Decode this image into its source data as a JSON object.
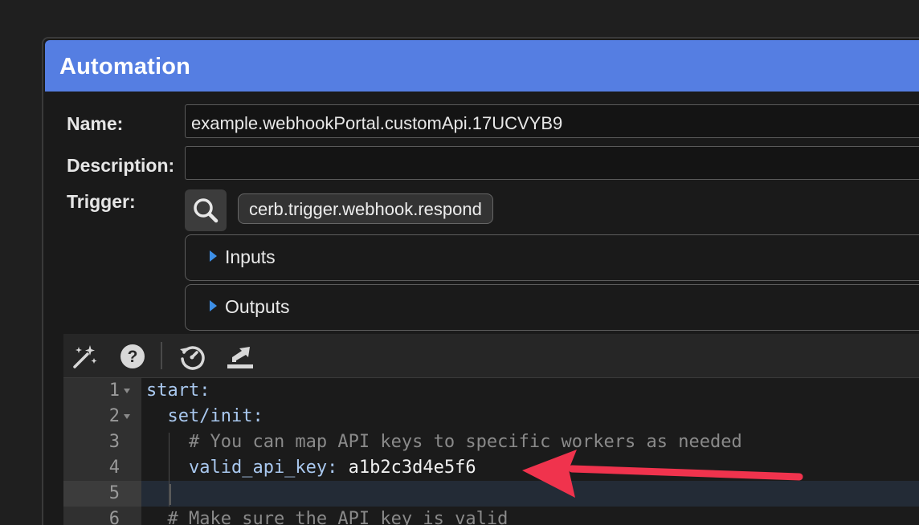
{
  "dialog": {
    "title": "Automation"
  },
  "form": {
    "name_label": "Name:",
    "name_value": "example.webhookPortal.customApi.17UCVYB9",
    "description_label": "Description:",
    "description_value": "",
    "trigger_label": "Trigger:",
    "trigger_value": "cerb.trigger.webhook.respond",
    "inputs_label": "Inputs",
    "outputs_label": "Outputs"
  },
  "toolbar": {
    "icons": [
      "magic-wand-icon",
      "help-icon",
      "history-icon",
      "export-icon"
    ]
  },
  "editor": {
    "lines": [
      {
        "number": "1",
        "text": "start:",
        "foldable": true
      },
      {
        "number": "2",
        "text": "  set/init:",
        "foldable": true
      },
      {
        "number": "3",
        "text": "    # You can map API keys to specific workers as needed",
        "foldable": false
      },
      {
        "number": "4",
        "text": "    valid_api_key: a1b2c3d4e5f6",
        "foldable": false
      },
      {
        "number": "5",
        "text": "",
        "foldable": false
      },
      {
        "number": "6",
        "text": "  # Make sure the API key is valid",
        "foldable": false
      }
    ]
  },
  "colors": {
    "titlebar": "#557ee2",
    "annotation_arrow": "#f0334d"
  }
}
